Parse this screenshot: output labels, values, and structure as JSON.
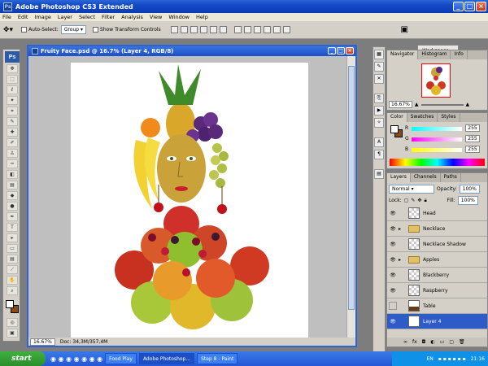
{
  "app": {
    "title": "Adobe Photoshop CS3 Extended",
    "logo": "Ps"
  },
  "menu": [
    "File",
    "Edit",
    "Image",
    "Layer",
    "Select",
    "Filter",
    "Analysis",
    "View",
    "Window",
    "Help"
  ],
  "options": {
    "auto_select_label": "Auto-Select:",
    "auto_select_value": "Group",
    "show_transform_label": "Show Transform Controls",
    "workspace_label": "Workspace"
  },
  "document": {
    "title": "Fruity Face.psd @ 16.7% (Layer 4, RGB/8)",
    "zoom": "16.67%",
    "doc_info": "Doc: 34,3M/357,4M"
  },
  "navigator": {
    "tabs": [
      "Navigator",
      "Histogram",
      "Info"
    ],
    "zoom": "16.67%"
  },
  "color": {
    "tabs": [
      "Color",
      "Swatches",
      "Styles"
    ],
    "channels": [
      {
        "label": "R",
        "value": "255",
        "color": "#e03030"
      },
      {
        "label": "G",
        "value": "255",
        "color": "#30c030"
      },
      {
        "label": "B",
        "value": "255",
        "color": "#3050e0"
      }
    ]
  },
  "layers": {
    "tabs": [
      "Layers",
      "Channels",
      "Paths"
    ],
    "blend_mode": "Normal",
    "opacity_label": "Opacity:",
    "opacity": "100%",
    "lock_label": "Lock:",
    "fill_label": "Fill:",
    "fill": "100%",
    "items": [
      {
        "name": "Head",
        "type": "layer",
        "visible": true,
        "selected": false
      },
      {
        "name": "Necklace",
        "type": "group",
        "visible": true,
        "selected": false
      },
      {
        "name": "Necklace Shadow",
        "type": "layer",
        "visible": true,
        "selected": false
      },
      {
        "name": "Apples",
        "type": "group",
        "visible": true,
        "selected": false
      },
      {
        "name": "Blackberry",
        "type": "layer",
        "visible": true,
        "selected": false
      },
      {
        "name": "Raspberry",
        "type": "layer",
        "visible": true,
        "selected": false
      },
      {
        "name": "Table",
        "type": "layer",
        "visible": false,
        "selected": false
      },
      {
        "name": "Layer 4",
        "type": "layer",
        "visible": true,
        "selected": true
      }
    ]
  },
  "taskbar": {
    "start": "start",
    "tasks": [
      {
        "label": "Food Play",
        "active": false
      },
      {
        "label": "Adobe Photoshop...",
        "active": true
      },
      {
        "label": "Step 8 - Paint",
        "active": false
      }
    ],
    "lang": "EN",
    "time": "21:16"
  },
  "colors": {
    "titlebar": "#1449c5",
    "selected_layer": "#2d5bc7"
  }
}
